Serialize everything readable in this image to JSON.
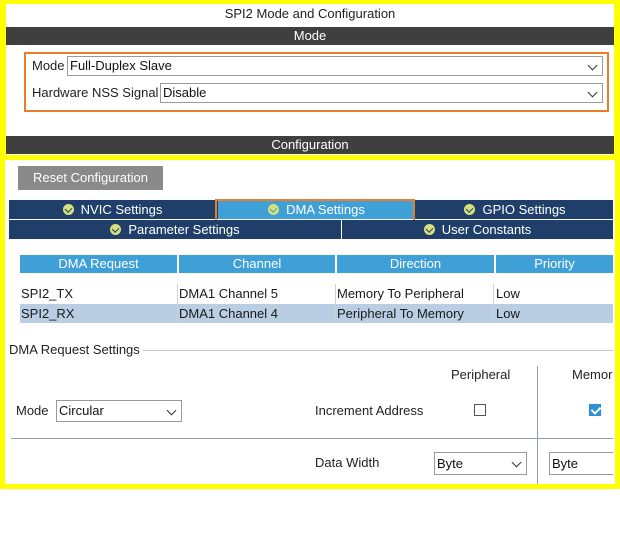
{
  "window": {
    "title": "SPI2 Mode and Configuration"
  },
  "mode_section": {
    "header": "Mode",
    "mode_label": "Mode",
    "mode_value": "Full-Duplex Slave",
    "nss_label": "Hardware NSS Signal",
    "nss_value": "Disable"
  },
  "config_section": {
    "header": "Configuration",
    "reset_button": "Reset Configuration",
    "tabs_row1": [
      "NVIC Settings",
      "DMA Settings",
      "GPIO Settings"
    ],
    "tabs_row2": [
      "Parameter Settings",
      "User Constants"
    ],
    "active_tab": "DMA Settings"
  },
  "dma_table": {
    "columns": [
      "DMA Request",
      "Channel",
      "Direction",
      "Priority"
    ],
    "rows": [
      [
        "SPI2_TX",
        "DMA1 Channel 5",
        "Memory To Peripheral",
        "Low"
      ],
      [
        "SPI2_RX",
        "DMA1 Channel 4",
        "Peripheral To Memory",
        "Low"
      ]
    ],
    "selected_row": 1
  },
  "request_settings": {
    "group_title": "DMA Request Settings",
    "mode_label": "Mode",
    "mode_value": "Circular",
    "peripheral_header": "Peripheral",
    "memory_header": "Memor",
    "increment_label": "Increment Address",
    "peripheral_increment": false,
    "memory_increment": true,
    "data_width_label": "Data Width",
    "peripheral_width": "Byte",
    "memory_width": "Byte"
  },
  "colors": {
    "accent_outline": "#e57f2a",
    "frame_yellow": "#ffff00",
    "tab_bar": "#1f3f6a",
    "tab_active": "#3fa0d8",
    "selected_row": "#b9cde3"
  }
}
